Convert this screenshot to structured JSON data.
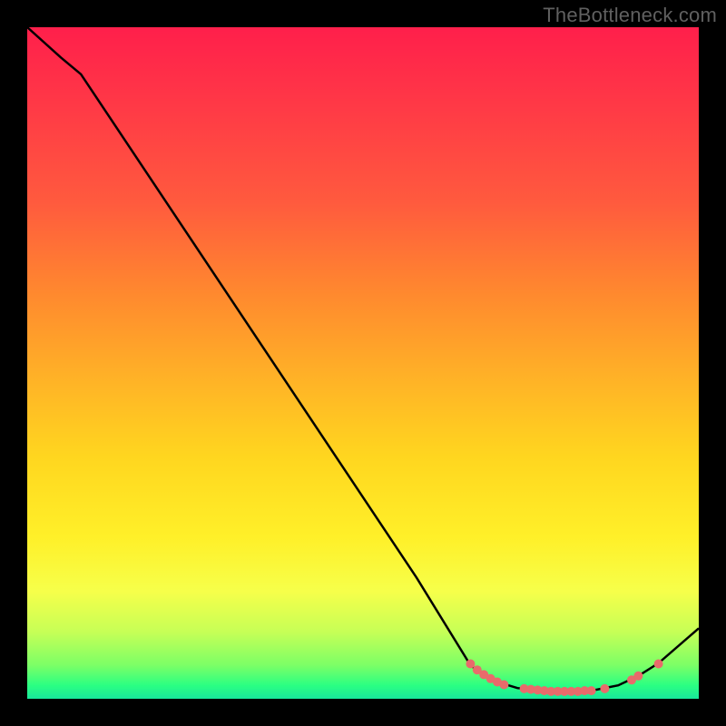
{
  "watermark": "TheBottleneck.com",
  "colors": {
    "background": "#000000",
    "curve": "#000000",
    "dots": "#e86b6b"
  },
  "chart_data": {
    "type": "line",
    "title": "",
    "xlabel": "",
    "ylabel": "",
    "xlim": [
      0,
      100
    ],
    "ylim": [
      0,
      100
    ],
    "curve": [
      {
        "x": 0,
        "y": 100
      },
      {
        "x": 5,
        "y": 95.5
      },
      {
        "x": 8,
        "y": 93
      },
      {
        "x": 58,
        "y": 18
      },
      {
        "x": 66,
        "y": 5
      },
      {
        "x": 68,
        "y": 3.5
      },
      {
        "x": 70,
        "y": 2.5
      },
      {
        "x": 73,
        "y": 1.6
      },
      {
        "x": 78,
        "y": 1.1
      },
      {
        "x": 84,
        "y": 1.2
      },
      {
        "x": 88,
        "y": 2.0
      },
      {
        "x": 91,
        "y": 3.4
      },
      {
        "x": 94,
        "y": 5.3
      },
      {
        "x": 100,
        "y": 10.5
      }
    ],
    "points": [
      {
        "x": 66,
        "y": 5.2
      },
      {
        "x": 67,
        "y": 4.3
      },
      {
        "x": 68,
        "y": 3.6
      },
      {
        "x": 69,
        "y": 3.0
      },
      {
        "x": 70,
        "y": 2.5
      },
      {
        "x": 71,
        "y": 2.1
      },
      {
        "x": 74,
        "y": 1.5
      },
      {
        "x": 75,
        "y": 1.4
      },
      {
        "x": 76,
        "y": 1.3
      },
      {
        "x": 77,
        "y": 1.2
      },
      {
        "x": 78,
        "y": 1.1
      },
      {
        "x": 79,
        "y": 1.1
      },
      {
        "x": 80,
        "y": 1.1
      },
      {
        "x": 81,
        "y": 1.1
      },
      {
        "x": 82,
        "y": 1.1
      },
      {
        "x": 83,
        "y": 1.2
      },
      {
        "x": 84,
        "y": 1.2
      },
      {
        "x": 86,
        "y": 1.5
      },
      {
        "x": 90,
        "y": 2.8
      },
      {
        "x": 91,
        "y": 3.4
      },
      {
        "x": 94,
        "y": 5.2
      }
    ]
  }
}
